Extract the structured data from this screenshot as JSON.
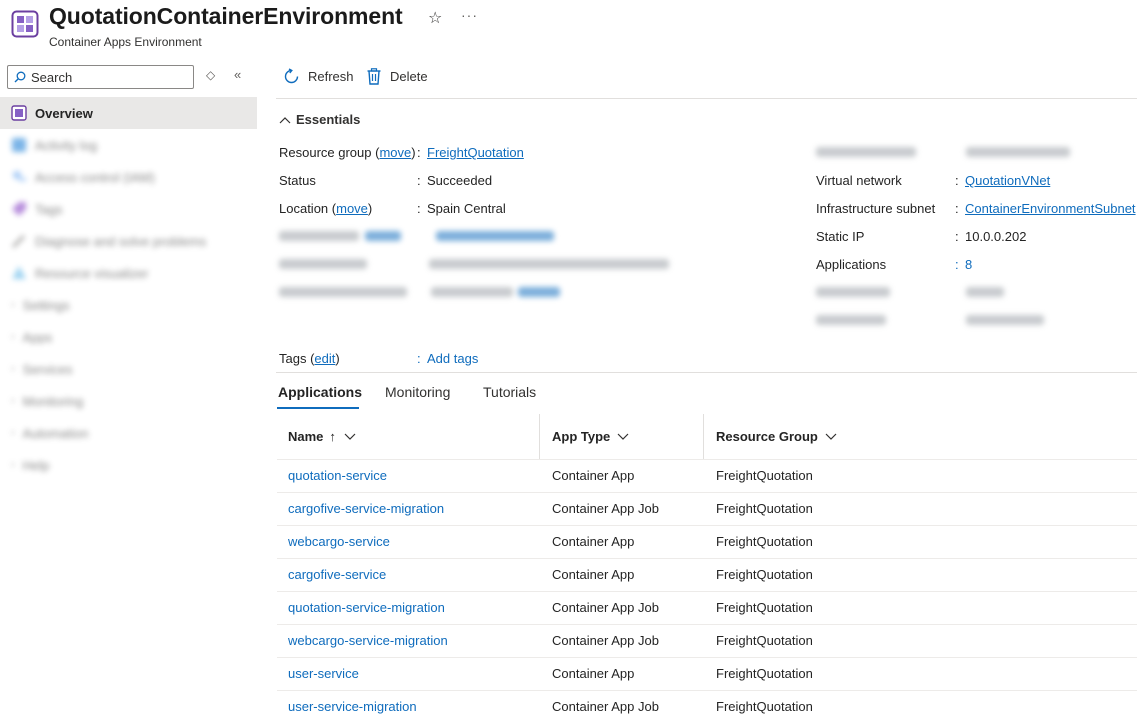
{
  "header": {
    "title": "QuotationContainerEnvironment",
    "subtitle": "Container Apps Environment",
    "favorite_icon": "star-icon",
    "more_label": "···"
  },
  "sidebar": {
    "search_placeholder": "Search",
    "items": [
      {
        "label": "Overview",
        "icon": "container-env-icon",
        "active": true
      },
      {
        "label": "Activity log",
        "icon": "activity-log-icon"
      },
      {
        "label": "Access control (IAM)",
        "icon": "iam-icon"
      },
      {
        "label": "Tags",
        "icon": "tag-icon"
      },
      {
        "label": "Diagnose and solve problems",
        "icon": "wrench-icon"
      },
      {
        "label": "Resource visualizer",
        "icon": "visualizer-icon"
      },
      {
        "label": "Settings",
        "icon": "chevron-right-icon"
      },
      {
        "label": "Apps",
        "icon": "chevron-right-icon"
      },
      {
        "label": "Services",
        "icon": "chevron-right-icon"
      },
      {
        "label": "Monitoring",
        "icon": "chevron-right-icon"
      },
      {
        "label": "Automation",
        "icon": "chevron-right-icon"
      },
      {
        "label": "Help",
        "icon": "chevron-right-icon"
      }
    ]
  },
  "toolbar": {
    "refresh_label": "Refresh",
    "delete_label": "Delete"
  },
  "essentials": {
    "heading": "Essentials",
    "left": {
      "resource_group_label": "Resource group",
      "move_label": "move",
      "resource_group_value": "FreightQuotation",
      "status_label": "Status",
      "status_value": "Succeeded",
      "location_label": "Location",
      "location_value": "Spain Central"
    },
    "right": {
      "vnet_label": "Virtual network",
      "vnet_value": "QuotationVNet",
      "subnet_label": "Infrastructure subnet",
      "subnet_value": "ContainerEnvironmentSubnet",
      "static_ip_label": "Static IP",
      "static_ip_value": "10.0.0.202",
      "applications_label": "Applications",
      "applications_value": "8"
    },
    "tags_label": "Tags",
    "tags_edit": "edit",
    "add_tags": "Add tags",
    "colon": ":"
  },
  "tabs": [
    "Applications",
    "Monitoring",
    "Tutorials"
  ],
  "table": {
    "columns": [
      {
        "label": "Name",
        "sort": "↑"
      },
      {
        "label": "App Type"
      },
      {
        "label": "Resource Group"
      }
    ],
    "rows": [
      {
        "name": "quotation-service",
        "type": "Container App",
        "group": "FreightQuotation"
      },
      {
        "name": "cargofive-service-migration",
        "type": "Container App Job",
        "group": "FreightQuotation"
      },
      {
        "name": "webcargo-service",
        "type": "Container App",
        "group": "FreightQuotation"
      },
      {
        "name": "cargofive-service",
        "type": "Container App",
        "group": "FreightQuotation"
      },
      {
        "name": "quotation-service-migration",
        "type": "Container App Job",
        "group": "FreightQuotation"
      },
      {
        "name": "webcargo-service-migration",
        "type": "Container App Job",
        "group": "FreightQuotation"
      },
      {
        "name": "user-service",
        "type": "Container App",
        "group": "FreightQuotation"
      },
      {
        "name": "user-service-migration",
        "type": "Container App Job",
        "group": "FreightQuotation"
      }
    ]
  }
}
